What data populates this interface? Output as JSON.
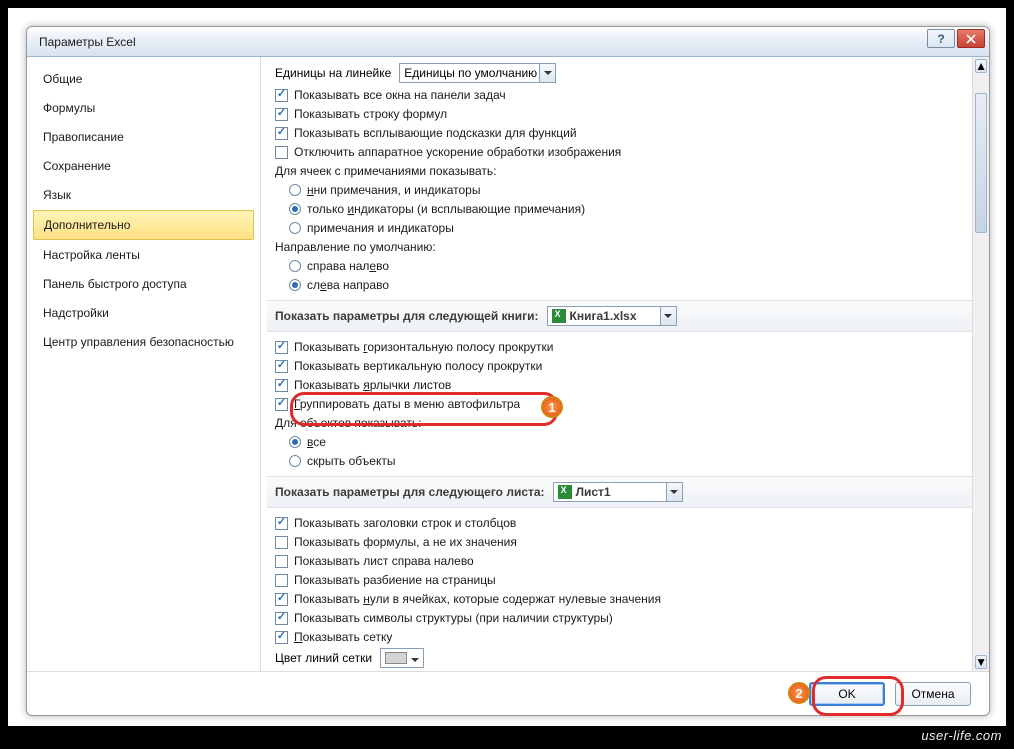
{
  "window": {
    "title": "Параметры Excel"
  },
  "sidebar": {
    "items": [
      {
        "label": "Общие"
      },
      {
        "label": "Формулы"
      },
      {
        "label": "Правописание"
      },
      {
        "label": "Сохранение"
      },
      {
        "label": "Язык"
      },
      {
        "label": "Дополнительно"
      },
      {
        "label": "Настройка ленты"
      },
      {
        "label": "Панель быстрого доступа"
      },
      {
        "label": "Надстройки"
      },
      {
        "label": "Центр управления безопасностью"
      }
    ],
    "selected": 5
  },
  "top": {
    "ruler_label": "Единицы на линейке",
    "ruler_value": "Единицы по умолчанию",
    "chk_allwin": "Показывать все окна на панели задач",
    "chk_formula": "Показывать строку формул",
    "chk_tips": "Показывать всплывающие подсказки для функций",
    "chk_hwaccel": "Отключить аппаратное ускорение обработки изображения",
    "comments_label": "Для ячеек с примечаниями показывать:",
    "r_none_pre": "ни примечания, ",
    "r_none_u": "н",
    "r_none_post": "и индикаторы",
    "r_ind_pre": "только ",
    "r_ind_u": "и",
    "r_ind_post": "ндикаторы (и всплывающие примечания)",
    "r_both": "примечания и индикаторы",
    "dir_label": "Направление по умолчанию:",
    "r_rtl_pre": "справа нал",
    "r_rtl_u": "е",
    "r_rtl_post": "во",
    "r_ltr_pre": "сл",
    "r_ltr_u": "е",
    "r_ltr_post": "ва направо"
  },
  "sect_book": {
    "title": "Показать параметры для следующей книги:",
    "value": "Книга1.xlsx"
  },
  "book": {
    "hscroll_pre": "Показывать ",
    "hscroll_u": "г",
    "hscroll_post": "оризонтальную полосу прокрутки",
    "vscroll": "Показывать вертикальную полосу прокрутки",
    "tabs_pre": "Показывать ",
    "tabs_u": "я",
    "tabs_post": "рлычки листов",
    "groupdates_pre": "",
    "groupdates_u": "Г",
    "groupdates_post": "руппировать даты в меню автофильтра",
    "objshow": "Для объектов показывать:",
    "r_all_u": "в",
    "r_all_post": "се",
    "r_hide": "скрыть объекты"
  },
  "sect_sheet": {
    "title": "Показать параметры для следующего листа:",
    "value": "Лист1"
  },
  "sheet": {
    "headers": "Показывать заголовки строк и столбцов",
    "formulas": "Показывать формулы, а не их значения",
    "rtl": "Показывать лист справа налево",
    "pagebreak": "Показывать разбиение на страницы",
    "zeros_pre": "Показывать ",
    "zeros_u": "н",
    "zeros_post": "ули в ячейках, которые содержат нулевые значения",
    "outline": "Показывать символы структуры (при наличии структуры)",
    "grid_pre": "",
    "grid_u": "П",
    "grid_post": "оказывать сетку",
    "gridcolor": "Цвет линий сетки"
  },
  "footer": {
    "ok": "OK",
    "cancel": "Отмена"
  },
  "watermark": "user-life.com"
}
